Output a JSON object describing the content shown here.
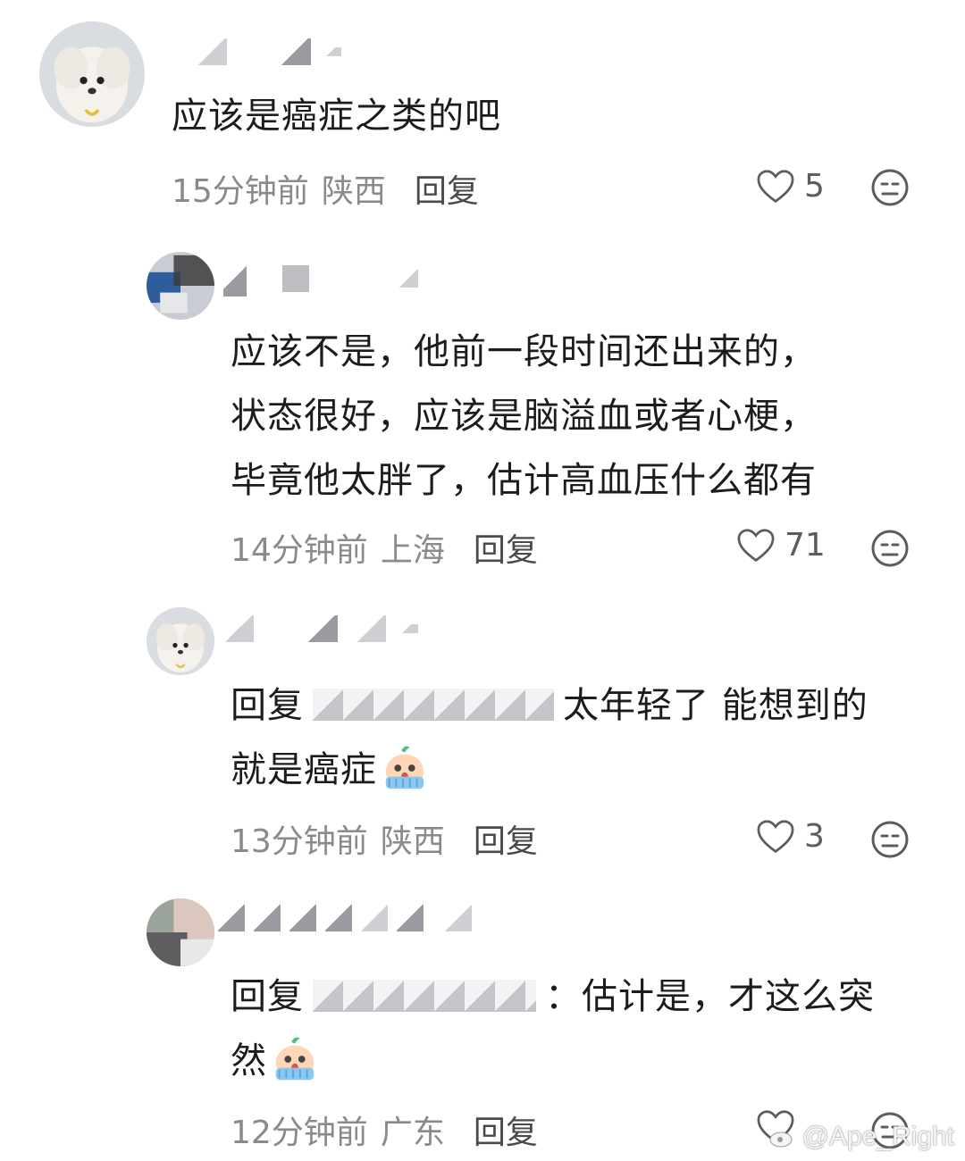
{
  "comments": [
    {
      "text": "应该是癌症之类的吧",
      "time": "15分钟前",
      "location": "陕西",
      "reply_label": "回复",
      "likes": "5"
    },
    {
      "text_lines": [
        "应该不是，他前一段时间还出来的，",
        "状态很好，应该是脑溢血或者心梗，",
        "毕竟他太胖了，估计高血压什么都有"
      ],
      "time": "14分钟前",
      "location": "上海",
      "reply_label": "回复",
      "likes": "71"
    },
    {
      "reply_prefix": "回复",
      "line1_tail": "太年轻了 能想到的",
      "line2": "就是癌症",
      "time": "13分钟前",
      "location": "陕西",
      "reply_label": "回复",
      "likes": "3"
    },
    {
      "reply_prefix": "回复",
      "line1_tail": "：估计是，才这么突",
      "line2": "然",
      "time": "12分钟前",
      "location": "广东",
      "reply_label": "回复"
    }
  ],
  "watermark": "@Ape_Right",
  "icons": {
    "like": "heart-outline-icon",
    "dislike": "neutral-face-icon",
    "emoji": "crying-emoji-icon"
  }
}
